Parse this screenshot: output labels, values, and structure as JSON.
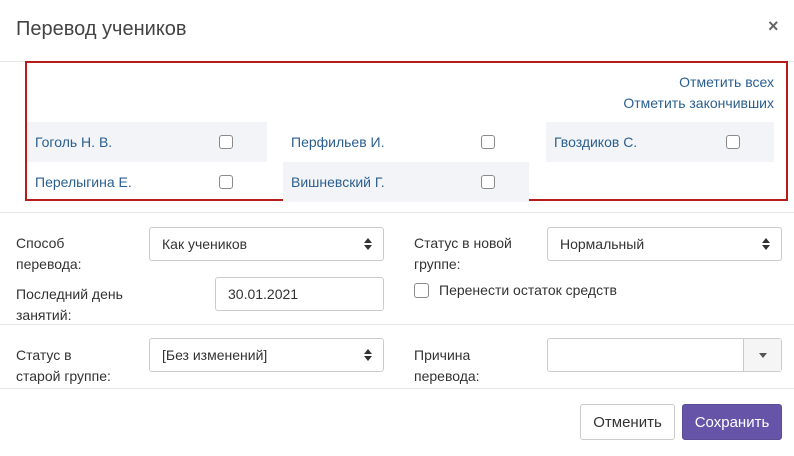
{
  "dialog": {
    "title": "Перевод учеников",
    "close_glyph": "×"
  },
  "students_panel": {
    "select_all": "Отметить всех",
    "select_finished": "Отметить закончивших",
    "students": [
      {
        "name": "Гоголь Н. В.",
        "checked": false
      },
      {
        "name": "Перфильев И.",
        "checked": false
      },
      {
        "name": "Гвоздиков С.",
        "checked": false
      },
      {
        "name": "Перелыгина Е.",
        "checked": false
      },
      {
        "name": "Вишневский Г.",
        "checked": false
      }
    ]
  },
  "form": {
    "transfer_method_label_1": "Способ",
    "transfer_method_label_2": "перевода:",
    "transfer_method_value": "Как учеников",
    "last_day_label_1": "Последний день",
    "last_day_label_2": "занятий:",
    "last_day_value": "30.01.2021",
    "new_status_label_1": "Статус в новой",
    "new_status_label_2": "группе:",
    "new_status_value": "Нормальный",
    "transfer_balance_label": "Перенести остаток средств",
    "transfer_balance_checked": false,
    "old_status_label_1": "Статус в",
    "old_status_label_2": "старой группе:",
    "old_status_value": "[Без изменений]",
    "reason_label_1": "Причина",
    "reason_label_2": "перевода:",
    "reason_value": ""
  },
  "footer": {
    "cancel_label": "Отменить",
    "save_label": "Сохранить"
  },
  "colors": {
    "accent": "#6554a8",
    "link": "#2b5f8f",
    "highlight_border": "#b71c1c"
  }
}
